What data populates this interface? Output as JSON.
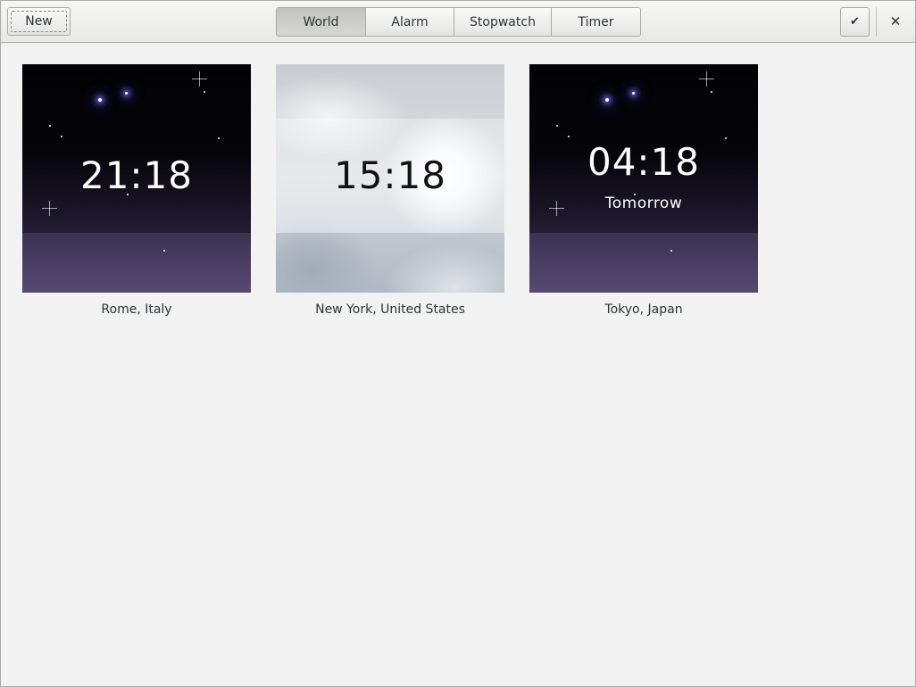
{
  "header": {
    "new_label": "New",
    "tabs": [
      {
        "label": "World",
        "active": true
      },
      {
        "label": "Alarm",
        "active": false
      },
      {
        "label": "Stopwatch",
        "active": false
      },
      {
        "label": "Timer",
        "active": false
      }
    ],
    "done_icon": "checkmark-icon",
    "close_icon": "close-icon",
    "done_glyph": "✔",
    "close_glyph": "✕"
  },
  "clocks": [
    {
      "city": "Rome, Italy",
      "time": "21:18",
      "day": "",
      "scene": "night"
    },
    {
      "city": "New York, United States",
      "time": "15:18",
      "day": "",
      "scene": "day"
    },
    {
      "city": "Tokyo, Japan",
      "time": "04:18",
      "day": "Tomorrow",
      "scene": "night"
    }
  ]
}
